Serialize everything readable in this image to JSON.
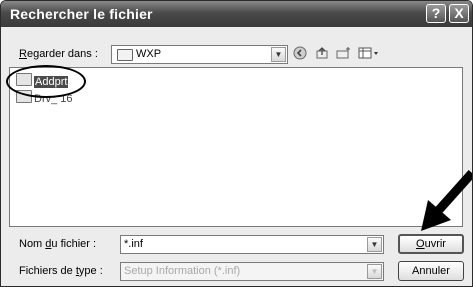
{
  "window": {
    "title": "Rechercher le fichier",
    "help_glyph": "?",
    "close_glyph": "X"
  },
  "lookin": {
    "label_u": "R",
    "label_rest": "egarder dans :",
    "value": "WXP"
  },
  "toolbar": {
    "icons": [
      "back-icon",
      "up-folder-icon",
      "new-folder-icon",
      "view-menu-icon"
    ]
  },
  "files": [
    {
      "name": "Addprt",
      "selected": true
    },
    {
      "name": "Drv_ 16",
      "selected": false
    }
  ],
  "filename": {
    "label_pre": "Nom ",
    "label_u": "d",
    "label_post": "u fichier :",
    "value": "*.inf"
  },
  "filetype": {
    "label_pre": "Fichiers de ",
    "label_u": "t",
    "label_post": "ype :",
    "value": "Setup Information (*.inf)"
  },
  "buttons": {
    "open_u": "O",
    "open_rest": "uvrir",
    "cancel": "Annuler"
  }
}
